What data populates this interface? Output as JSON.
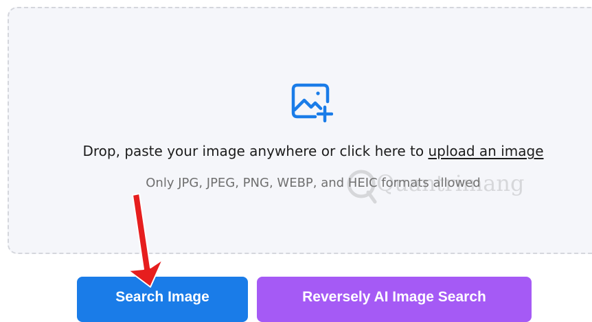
{
  "dropzone": {
    "icon": "image-plus-icon",
    "prompt_text": "Drop, paste your image anywhere or click here to ",
    "upload_link_label": "upload an image",
    "formats_text": "Only JPG, JPEG, PNG, WEBP, and HEIC formats allowed"
  },
  "buttons": {
    "search_label": "Search Image",
    "reverse_label": "Reversely AI Image Search"
  },
  "watermark": {
    "text": "Quantrimang"
  },
  "colors": {
    "primary_blue": "#1a7ce8",
    "accent_purple": "#a55af5",
    "dropzone_bg": "#f5f6fa",
    "annotation_red": "#e61e1e"
  }
}
